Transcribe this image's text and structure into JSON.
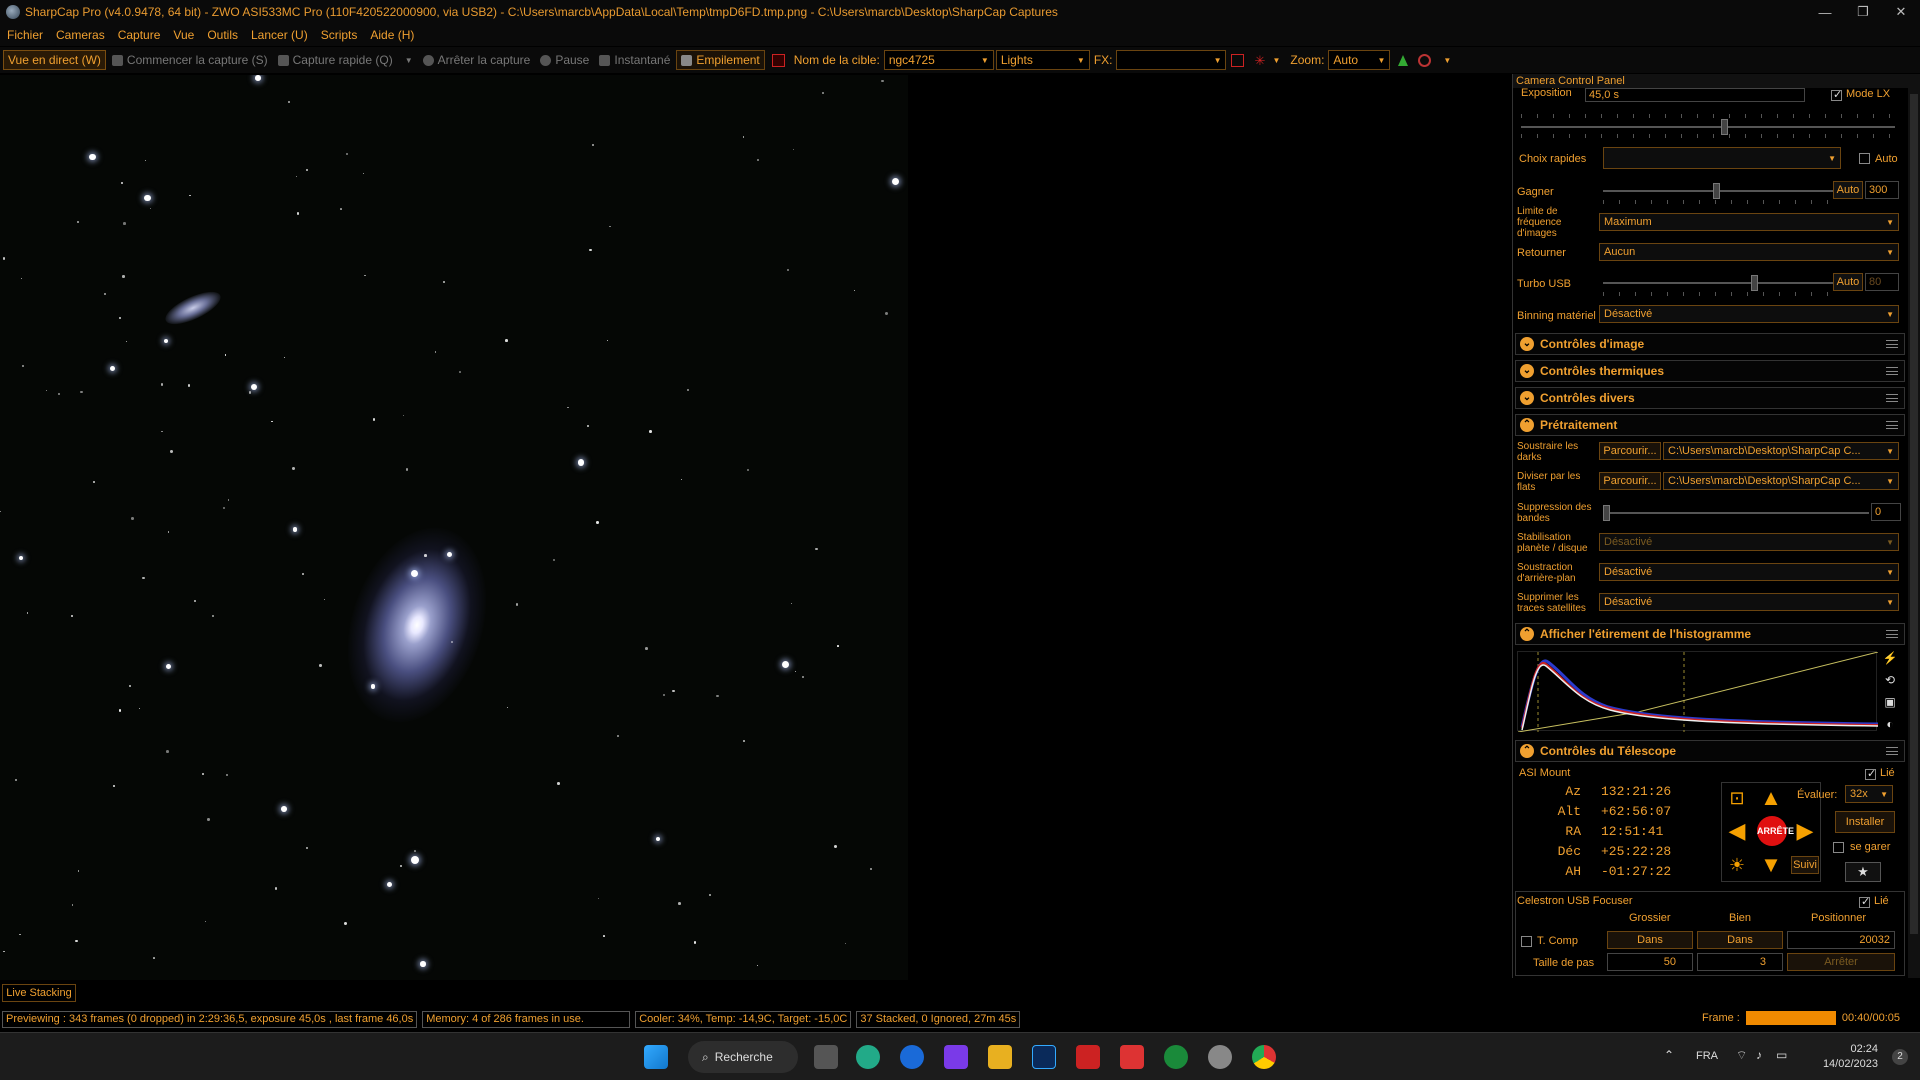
{
  "window": {
    "title": "SharpCap Pro (v4.0.9478, 64 bit) - ZWO ASI533MC Pro (110F420522000900, via USB2) - C:\\Users\\marcb\\AppData\\Local\\Temp\\tmpD6FD.tmp.png - C:\\Users\\marcb\\Desktop\\SharpCap Captures",
    "controls": [
      "—",
      "❐",
      "✕"
    ]
  },
  "menu": [
    "Fichier",
    "Cameras",
    "Capture",
    "Vue",
    "Outils",
    "Lancer (U)",
    "Scripts",
    "Aide (H)"
  ],
  "toolbar": {
    "live_view": "Vue en direct (W)",
    "start_capture": "Commencer la capture (S)",
    "quick_capture": "Capture rapide (Q)",
    "stop_capture": "Arrêter la capture",
    "pause": "Pause",
    "snapshot": "Instantané",
    "stacking": "Empilement",
    "target_label": "Nom de la cible:",
    "target_value": "ngc4725",
    "frame_type": "Lights",
    "fx_label": "FX:",
    "fx_value": "",
    "zoom_label": "Zoom:",
    "zoom_value": "Auto"
  },
  "panel": {
    "title": "Camera Control Panel",
    "exposure_label": "Exposition",
    "exposure_value": "45,0 s",
    "lx_mode": "Mode LX",
    "quick_choice_label": "Choix rapides",
    "quick_choice_value": "",
    "auto_label": "Auto",
    "gain_label": "Gagner",
    "gain_auto": "Auto",
    "gain_value": "300",
    "framerate_label": "Limite de fréquence d'images",
    "framerate_value": "Maximum",
    "flip_label": "Retourner",
    "flip_value": "Aucun",
    "usb_label": "Turbo USB",
    "usb_auto": "Auto",
    "usb_value": "80",
    "binning_label": "Binning matériel",
    "binning_value": "Désactivé",
    "sections": {
      "image": "Contrôles d'image",
      "thermal": "Contrôles thermiques",
      "misc": "Contrôles divers",
      "preprocessing": "Prétraitement",
      "histogram": "Afficher l'étirement de l'histogramme",
      "telescope": "Contrôles du Télescope"
    },
    "darks_label": "Soustraire les darks",
    "darks_btn": "Parcourir...",
    "darks_path": "C:\\Users\\marcb\\Desktop\\SharpCap C...",
    "flats_label": "Diviser par les flats",
    "flats_btn": "Parcourir...",
    "flats_path": "C:\\Users\\marcb\\Desktop\\SharpCap C...",
    "banding_label": "Suppression des bandes",
    "banding_value": "0",
    "stabilization_label": "Stabilisation planète / disque",
    "stabilization_value": "Désactivé",
    "background_label": "Soustraction d'arrière-plan",
    "background_value": "Désactivé",
    "satellite_label": "Supprimer les traces satellites",
    "satellite_value": "Désactivé"
  },
  "mount": {
    "name": "ASI Mount",
    "linked": "Lié",
    "rows": [
      {
        "k": "Az",
        "v": "132:21:26"
      },
      {
        "k": "Alt",
        "v": "+62:56:07"
      },
      {
        "k": "RA",
        "v": "12:51:41"
      },
      {
        "k": "Déc",
        "v": "+25:22:28"
      },
      {
        "k": "AH",
        "v": "-01:27:22"
      }
    ],
    "rate_label": "Évaluer:",
    "rate_value": "32x",
    "stop": "ARRÊTE",
    "install": "Installer",
    "park": "se garer",
    "track": "Suivi"
  },
  "focuser": {
    "name": "Celestron USB Focuser",
    "linked": "Lié",
    "coarse": "Grossier",
    "fine": "Bien",
    "position_label": "Positionner",
    "tcomp": "T. Comp",
    "in1": "Dans",
    "in2": "Dans",
    "position": "20032",
    "step_label": "Taille de pas",
    "step_coarse": "50",
    "step_fine": "3",
    "stop": "Arrêter"
  },
  "live_stacking": "Live Stacking",
  "status": {
    "preview": "Previewing : 343 frames (0 dropped) in 2:29:36,5, exposure 45,0s , last frame 46,0s",
    "memory": "Memory: 4 of 286 frames in use.",
    "cooler": "Cooler: 34%, Temp: -14,9C, Target: -15,0C",
    "stacked": "37 Stacked, 0 Ignored, 27m 45s",
    "frame_label": "Frame :",
    "frame_time": "00:40/00:05"
  },
  "taskbar": {
    "search": "Recherche",
    "lang": "FRA",
    "time": "02:24",
    "date": "14/02/2023",
    "badge": "2"
  }
}
